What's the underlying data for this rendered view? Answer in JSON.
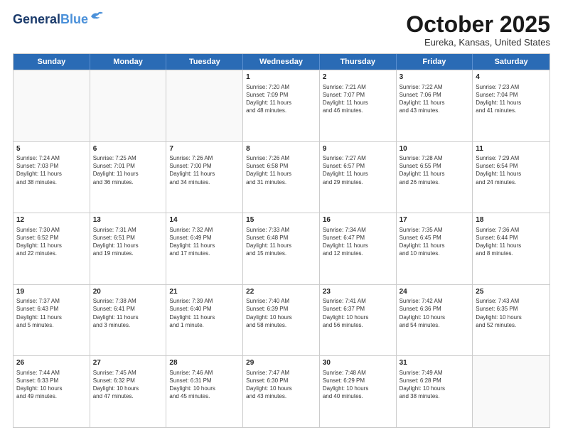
{
  "header": {
    "logo_line1": "General",
    "logo_line2": "Blue",
    "month_title": "October 2025",
    "location": "Eureka, Kansas, United States"
  },
  "days_of_week": [
    "Sunday",
    "Monday",
    "Tuesday",
    "Wednesday",
    "Thursday",
    "Friday",
    "Saturday"
  ],
  "weeks": [
    [
      {
        "day": "",
        "empty": true
      },
      {
        "day": "",
        "empty": true
      },
      {
        "day": "",
        "empty": true
      },
      {
        "day": "1",
        "info": "Sunrise: 7:20 AM\nSunset: 7:09 PM\nDaylight: 11 hours\nand 48 minutes."
      },
      {
        "day": "2",
        "info": "Sunrise: 7:21 AM\nSunset: 7:07 PM\nDaylight: 11 hours\nand 46 minutes."
      },
      {
        "day": "3",
        "info": "Sunrise: 7:22 AM\nSunset: 7:06 PM\nDaylight: 11 hours\nand 43 minutes."
      },
      {
        "day": "4",
        "info": "Sunrise: 7:23 AM\nSunset: 7:04 PM\nDaylight: 11 hours\nand 41 minutes."
      }
    ],
    [
      {
        "day": "5",
        "info": "Sunrise: 7:24 AM\nSunset: 7:03 PM\nDaylight: 11 hours\nand 38 minutes."
      },
      {
        "day": "6",
        "info": "Sunrise: 7:25 AM\nSunset: 7:01 PM\nDaylight: 11 hours\nand 36 minutes."
      },
      {
        "day": "7",
        "info": "Sunrise: 7:26 AM\nSunset: 7:00 PM\nDaylight: 11 hours\nand 34 minutes."
      },
      {
        "day": "8",
        "info": "Sunrise: 7:26 AM\nSunset: 6:58 PM\nDaylight: 11 hours\nand 31 minutes."
      },
      {
        "day": "9",
        "info": "Sunrise: 7:27 AM\nSunset: 6:57 PM\nDaylight: 11 hours\nand 29 minutes."
      },
      {
        "day": "10",
        "info": "Sunrise: 7:28 AM\nSunset: 6:55 PM\nDaylight: 11 hours\nand 26 minutes."
      },
      {
        "day": "11",
        "info": "Sunrise: 7:29 AM\nSunset: 6:54 PM\nDaylight: 11 hours\nand 24 minutes."
      }
    ],
    [
      {
        "day": "12",
        "info": "Sunrise: 7:30 AM\nSunset: 6:52 PM\nDaylight: 11 hours\nand 22 minutes."
      },
      {
        "day": "13",
        "info": "Sunrise: 7:31 AM\nSunset: 6:51 PM\nDaylight: 11 hours\nand 19 minutes."
      },
      {
        "day": "14",
        "info": "Sunrise: 7:32 AM\nSunset: 6:49 PM\nDaylight: 11 hours\nand 17 minutes."
      },
      {
        "day": "15",
        "info": "Sunrise: 7:33 AM\nSunset: 6:48 PM\nDaylight: 11 hours\nand 15 minutes."
      },
      {
        "day": "16",
        "info": "Sunrise: 7:34 AM\nSunset: 6:47 PM\nDaylight: 11 hours\nand 12 minutes."
      },
      {
        "day": "17",
        "info": "Sunrise: 7:35 AM\nSunset: 6:45 PM\nDaylight: 11 hours\nand 10 minutes."
      },
      {
        "day": "18",
        "info": "Sunrise: 7:36 AM\nSunset: 6:44 PM\nDaylight: 11 hours\nand 8 minutes."
      }
    ],
    [
      {
        "day": "19",
        "info": "Sunrise: 7:37 AM\nSunset: 6:43 PM\nDaylight: 11 hours\nand 5 minutes."
      },
      {
        "day": "20",
        "info": "Sunrise: 7:38 AM\nSunset: 6:41 PM\nDaylight: 11 hours\nand 3 minutes."
      },
      {
        "day": "21",
        "info": "Sunrise: 7:39 AM\nSunset: 6:40 PM\nDaylight: 11 hours\nand 1 minute."
      },
      {
        "day": "22",
        "info": "Sunrise: 7:40 AM\nSunset: 6:39 PM\nDaylight: 10 hours\nand 58 minutes."
      },
      {
        "day": "23",
        "info": "Sunrise: 7:41 AM\nSunset: 6:37 PM\nDaylight: 10 hours\nand 56 minutes."
      },
      {
        "day": "24",
        "info": "Sunrise: 7:42 AM\nSunset: 6:36 PM\nDaylight: 10 hours\nand 54 minutes."
      },
      {
        "day": "25",
        "info": "Sunrise: 7:43 AM\nSunset: 6:35 PM\nDaylight: 10 hours\nand 52 minutes."
      }
    ],
    [
      {
        "day": "26",
        "info": "Sunrise: 7:44 AM\nSunset: 6:33 PM\nDaylight: 10 hours\nand 49 minutes."
      },
      {
        "day": "27",
        "info": "Sunrise: 7:45 AM\nSunset: 6:32 PM\nDaylight: 10 hours\nand 47 minutes."
      },
      {
        "day": "28",
        "info": "Sunrise: 7:46 AM\nSunset: 6:31 PM\nDaylight: 10 hours\nand 45 minutes."
      },
      {
        "day": "29",
        "info": "Sunrise: 7:47 AM\nSunset: 6:30 PM\nDaylight: 10 hours\nand 43 minutes."
      },
      {
        "day": "30",
        "info": "Sunrise: 7:48 AM\nSunset: 6:29 PM\nDaylight: 10 hours\nand 40 minutes."
      },
      {
        "day": "31",
        "info": "Sunrise: 7:49 AM\nSunset: 6:28 PM\nDaylight: 10 hours\nand 38 minutes."
      },
      {
        "day": "",
        "empty": true
      }
    ]
  ]
}
